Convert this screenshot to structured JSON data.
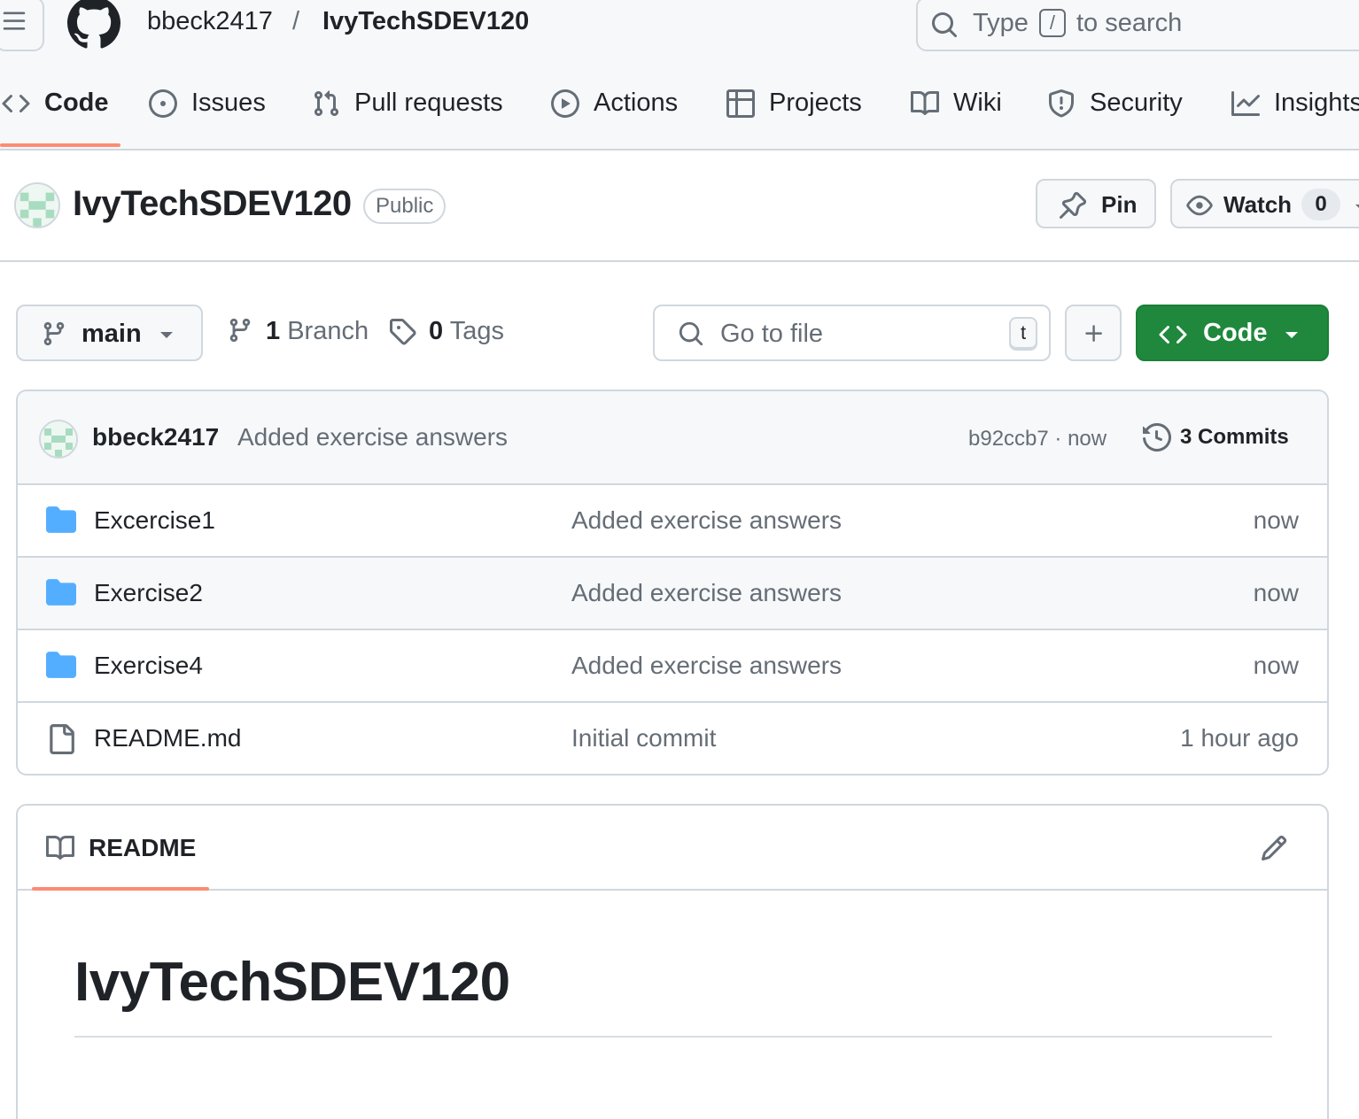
{
  "header": {
    "owner": "bbeck2417",
    "separator": "/",
    "repo": "IvyTechSDEV120",
    "search": {
      "prefix": "Type",
      "key": "/",
      "suffix": "to search"
    }
  },
  "tabs": [
    {
      "label": "Code",
      "icon": "code-icon",
      "active": true
    },
    {
      "label": "Issues",
      "icon": "issue-icon"
    },
    {
      "label": "Pull requests",
      "icon": "pull-request-icon"
    },
    {
      "label": "Actions",
      "icon": "play-icon"
    },
    {
      "label": "Projects",
      "icon": "table-icon"
    },
    {
      "label": "Wiki",
      "icon": "book-icon"
    },
    {
      "label": "Security",
      "icon": "shield-icon"
    },
    {
      "label": "Insights",
      "icon": "graph-icon"
    }
  ],
  "repo": {
    "name": "IvyTechSDEV120",
    "visibility": "Public",
    "pin_label": "Pin",
    "watch_label": "Watch",
    "watch_count": "0"
  },
  "nav": {
    "branch": "main",
    "branch_count": "1",
    "branch_label": "Branch",
    "tag_count": "0",
    "tag_label": "Tags",
    "goto_placeholder": "Go to file",
    "goto_key": "t",
    "code_button": "Code"
  },
  "latest_commit": {
    "author": "bbeck2417",
    "message": "Added exercise answers",
    "sha_time": "b92ccb7 · now",
    "commits_label": "3 Commits"
  },
  "files": [
    {
      "name": "Excercise1",
      "type": "folder",
      "message": "Added exercise answers",
      "time": "now"
    },
    {
      "name": "Exercise2",
      "type": "folder",
      "message": "Added exercise answers",
      "time": "now"
    },
    {
      "name": "Exercise4",
      "type": "folder",
      "message": "Added exercise answers",
      "time": "now"
    },
    {
      "name": "README.md",
      "type": "file",
      "message": "Initial commit",
      "time": "1 hour ago"
    }
  ],
  "readme": {
    "tab_label": "README",
    "heading": "IvyTechSDEV120"
  },
  "colors": {
    "accent_underline": "#fd8c73",
    "primary_button": "#1f883d",
    "folder": "#54aeff",
    "muted_text": "#656d76"
  }
}
